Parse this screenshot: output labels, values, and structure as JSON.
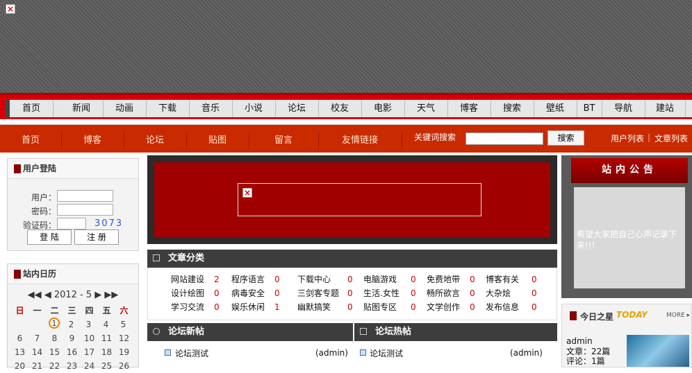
{
  "nav_main": [
    "首页",
    "新闻",
    "动画",
    "下载",
    "音乐",
    "小说",
    "论坛",
    "校友",
    "电影",
    "天气",
    "博客",
    "搜索",
    "壁纸",
    "BT",
    "导航",
    "建站"
  ],
  "nav_sub": [
    "首页",
    "博客",
    "论坛",
    "贴图",
    "留言",
    "友情链接"
  ],
  "search": {
    "label": "关键词搜索",
    "button": "搜索"
  },
  "right_links": [
    "用户列表",
    "文章列表"
  ],
  "login": {
    "title": "用户登陆",
    "user_label": "用户：",
    "pass_label": "密码：",
    "code_label": "验证码：",
    "code": "3073",
    "login_btn": "登 陆",
    "register_btn": "注 册"
  },
  "calendar": {
    "title": "站内日历",
    "nav": "◀◀ ◀  2012 - 5  ▶ ▶▶",
    "weekdays": [
      "日",
      "一",
      "二",
      "三",
      "四",
      "五",
      "六"
    ],
    "weeks": [
      [
        "",
        "",
        "1",
        "2",
        "3",
        "4",
        "5"
      ],
      [
        "6",
        "7",
        "8",
        "9",
        "10",
        "11",
        "12"
      ],
      [
        "13",
        "14",
        "15",
        "16",
        "17",
        "18",
        "19"
      ],
      [
        "20",
        "21",
        "22",
        "23",
        "24",
        "25",
        "26"
      ]
    ]
  },
  "categories": {
    "title": "文章分类",
    "rows": [
      [
        [
          "网站建设",
          "2"
        ],
        [
          "程序语言",
          "0"
        ],
        [
          "下载中心",
          "0"
        ],
        [
          "电脑游戏",
          "0"
        ],
        [
          "免费地带",
          "0"
        ],
        [
          "博客有关",
          "0"
        ]
      ],
      [
        [
          "设计绘图",
          "0"
        ],
        [
          "病毒安全",
          "0"
        ],
        [
          "三剑客专题",
          "0"
        ],
        [
          "生活.女性",
          "0"
        ],
        [
          "畅所欲言",
          "0"
        ],
        [
          "大杂烩",
          "0"
        ]
      ],
      [
        [
          "学习交流",
          "0"
        ],
        [
          "娱乐休闲",
          "1"
        ],
        [
          "幽默搞笑",
          "0"
        ],
        [
          "贴图专区",
          "0"
        ],
        [
          "文学创作",
          "0"
        ],
        [
          "发布信息",
          "0"
        ]
      ]
    ]
  },
  "forum_new": {
    "title": "论坛新帖",
    "items": [
      [
        "论坛测试",
        "(admin)"
      ]
    ]
  },
  "forum_hot": {
    "title": "论坛热帖",
    "items": [
      [
        "论坛测试",
        "(admin)"
      ]
    ]
  },
  "notice": {
    "title": "站内公告",
    "text": "希望大家把自己心声记录下来!!!"
  },
  "star": {
    "title": "今日之星",
    "badge": "TODAY",
    "more": "MORE ▸",
    "name": "admin",
    "articles": "文章：22篇",
    "comments": "评论：1篇"
  },
  "colors": {
    "main_red": "#d60000",
    "sub_bar": "#c92a00",
    "dark_panel": "#3d3d3d"
  }
}
